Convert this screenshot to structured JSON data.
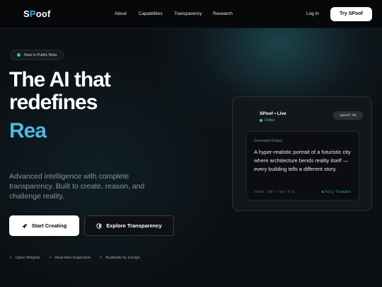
{
  "nav": {
    "logo_s": "S",
    "logo_p": "P",
    "logo_rest": "oof",
    "links": [
      "About",
      "Capabilities",
      "Transparency",
      "Research"
    ],
    "login": "Log in",
    "cta": "Try SPoof"
  },
  "badge": {
    "text": "Now in Public Beta",
    "dot_color": "#35c873"
  },
  "hero": {
    "line1": "The AI that",
    "line2": "redefines",
    "line3": "Rea",
    "description": "Advanced intelligence with complete transparency. Built to create, reason, and challenge reality.",
    "accent_color": "#4fb8e0"
  },
  "buttons": {
    "primary": {
      "label": "Start Creating",
      "icon": "rocket-icon"
    },
    "secondary": {
      "label": "Explore Transparency",
      "icon": "shield-icon"
    }
  },
  "features": [
    "Open Weights",
    "Real-time Inspection",
    "Auditable by Design"
  ],
  "card": {
    "title": "SPoof • Live",
    "status": "Online",
    "model": "spoof-4o",
    "output_label": "Generated Output",
    "output_text": "A hyper-realistic portrait of a futuristic city where architecture bends reality itself — every building tells a different story.",
    "meta": "Tokens: 184 • Time: 0.4s",
    "trace": "● Fully Traceable"
  }
}
